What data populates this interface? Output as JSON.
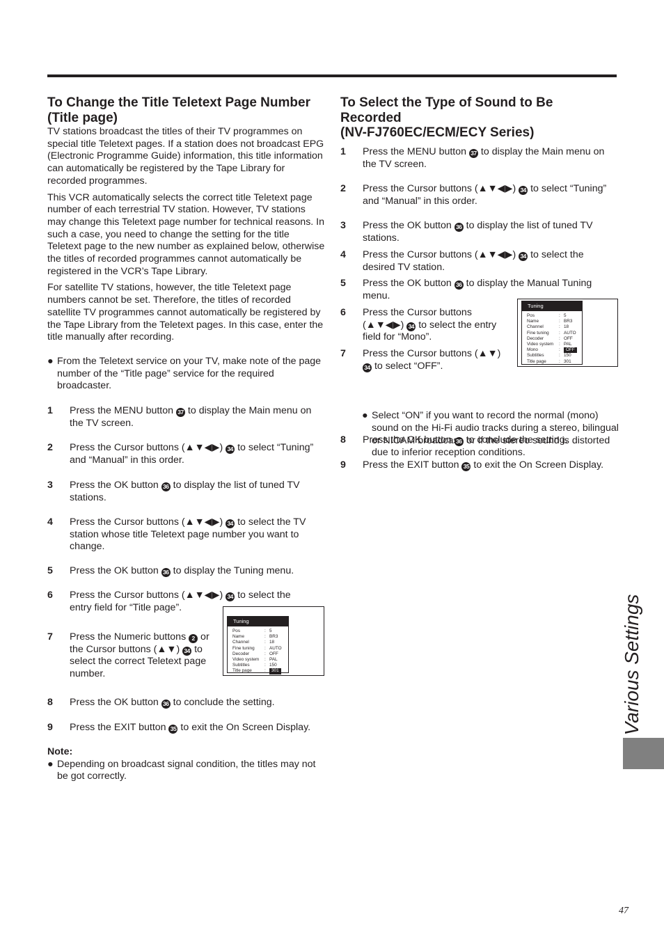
{
  "left": {
    "heading": [
      "To Change the Title Teletext Page Number",
      "(Title page)"
    ],
    "paragraphs": [
      "TV stations broadcast the titles of their TV programmes on special title Teletext pages. If a station does not broadcast EPG (Electronic Programme Guide) information, this title information can automatically be registered by the Tape Library for recorded programmes.",
      "This VCR automatically selects the correct title Teletext page number of each terrestrial TV station. However, TV stations may change this Teletext page number for technical reasons. In such a case, you need to change the setting for the title Teletext page to the new number as explained below, otherwise the titles of recorded programmes cannot automatically be registered in the VCR’s Tape Library.",
      "For satellite TV stations, however, the title Teletext page numbers cannot be set. Therefore, the titles of recorded satellite TV programmes cannot automatically be registered by the Tape Library from the Teletext pages. In this case, enter the title manually after recording."
    ],
    "bullet": "From the Teletext service on your TV, make note of the page number of the “Title page” service for the required broadcaster.",
    "steps": [
      {
        "num": "1",
        "parts": [
          "Press the MENU button ",
          "37",
          " to display the Main menu on the TV screen."
        ]
      },
      {
        "num": "2",
        "parts": [
          "Press the Cursor buttons (▲▼◀▶) ",
          "34",
          " to select “Tuning” and “Manual” in this order."
        ]
      },
      {
        "num": "3",
        "parts": [
          "Press the OK button ",
          "36",
          " to display the list of tuned TV stations."
        ]
      },
      {
        "num": "4",
        "parts": [
          "Press the Cursor buttons (▲▼◀▶) ",
          "34",
          " to select the TV station whose title Teletext page number you want to change."
        ]
      },
      {
        "num": "5",
        "parts": [
          "Press the OK button ",
          "36",
          " to display the Tuning menu."
        ]
      },
      {
        "num": "6",
        "parts": [
          "Press the Cursor buttons (▲▼◀▶) ",
          "34",
          " to select the entry field for “Title page”."
        ]
      },
      {
        "num": "7",
        "parts": [
          "Press the Numeric buttons ",
          "2",
          " or the Cursor buttons (▲▼) ",
          "34",
          " to select the correct Teletext page number."
        ]
      },
      {
        "num": "8",
        "parts": [
          "Press the OK button ",
          "36",
          " to conclude the setting."
        ]
      },
      {
        "num": "9",
        "parts": [
          "Press the EXIT button ",
          "35",
          " to exit the On Screen Display."
        ]
      }
    ],
    "note_label": "Note:",
    "note": "Depending on broadcast signal condition, the titles may not be got correctly.",
    "osd": {
      "title": "Tuning",
      "rows": [
        {
          "k": "Pos",
          "v": "5"
        },
        {
          "k": "Name",
          "v": "BR3"
        },
        {
          "k": "Channel",
          "v": "18"
        },
        {
          "k": "Fine tuning",
          "v": "AUTO"
        },
        {
          "k": "Decoder",
          "v": "OFF"
        },
        {
          "k": "Video system",
          "v": "PAL"
        },
        {
          "k": "Subtitles",
          "v": "150"
        },
        {
          "k": "Title page",
          "v": "301",
          "hl": true
        }
      ]
    }
  },
  "right": {
    "heading": [
      "To Select the Type of Sound to Be",
      "Recorded",
      "(NV-FJ760EC/ECM/ECY Series)"
    ],
    "steps": [
      {
        "num": "1",
        "parts": [
          "Press the MENU button ",
          "37",
          " to display the Main menu on the TV screen."
        ]
      },
      {
        "num": "2",
        "parts": [
          "Press the Cursor buttons (▲▼◀▶) ",
          "34",
          " to select “Tuning” and “Manual” in this order."
        ]
      },
      {
        "num": "3",
        "parts": [
          "Press the OK button ",
          "36",
          " to display the list of tuned TV stations."
        ]
      },
      {
        "num": "4",
        "parts": [
          "Press the Cursor buttons (▲▼◀▶) ",
          "34",
          " to select the desired TV station."
        ]
      },
      {
        "num": "5",
        "parts": [
          "Press the OK button ",
          "36",
          " to display the Manual Tuning menu."
        ]
      },
      {
        "num": "6",
        "parts": [
          "Press the Cursor buttons (▲▼◀▶) ",
          "34",
          " to select the entry field for “Mono”."
        ]
      },
      {
        "num": "7",
        "parts": [
          "Press the Cursor buttons (▲▼) ",
          "34",
          " to select “OFF”."
        ]
      },
      {
        "num": "8",
        "parts": [
          "Press the OK button ",
          "36",
          " to conclude the setting."
        ]
      },
      {
        "num": "9",
        "parts": [
          "Press the EXIT button ",
          "35",
          " to exit the On Screen Display."
        ]
      }
    ],
    "bullet": "Select “ON” if you want to record the normal (mono) sound on the Hi-Fi audio tracks during a stereo, bilingual or NICAM broadcast, or if the stereo sound is distorted due to inferior reception conditions.",
    "osd": {
      "title": "Tuning",
      "rows": [
        {
          "k": "Pos",
          "v": "5"
        },
        {
          "k": "Name",
          "v": "BR3"
        },
        {
          "k": "Channel",
          "v": "18"
        },
        {
          "k": "Fine tuning",
          "v": "AUTO"
        },
        {
          "k": "Decoder",
          "v": "OFF"
        },
        {
          "k": "Video system",
          "v": "PAL"
        },
        {
          "k": "Mono",
          "v": "OFF",
          "hl": true
        },
        {
          "k": "Subtitles",
          "v": "150"
        },
        {
          "k": "Title page",
          "v": "301"
        }
      ]
    }
  },
  "side_tab": "Various Settings",
  "page_number": "47",
  "bullet_char": "●"
}
